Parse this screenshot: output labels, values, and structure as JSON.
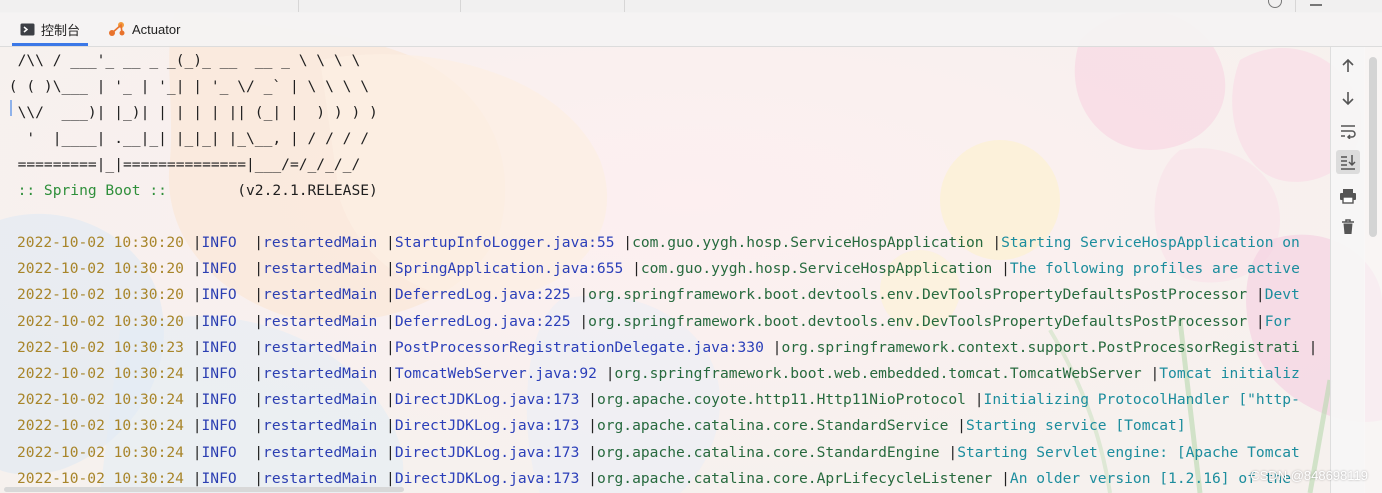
{
  "tabs": [
    {
      "label": "控制台",
      "icon": "console-icon",
      "active": true
    },
    {
      "label": "Actuator",
      "icon": "actuator-icon",
      "active": false
    }
  ],
  "banner": [
    "  /\\\\ / ___'_ __ _ _(_)_ __  __ _ \\ \\ \\ \\",
    " ( ( )\\___ | '_ | '_| | '_ \\/ _` | \\ \\ \\ \\",
    "  \\\\/  ___)| |_)| | | | | || (_| |  ) ) ) )",
    "   '  |____| .__|_| |_|_| |_\\__, | / / / /",
    "  =========|_|==============|___/=/_/_/_/"
  ],
  "spring_label": "  :: Spring Boot ::",
  "spring_version": "        (v2.2.1.RELEASE)",
  "log_lines": [
    {
      "ts": "2022-10-02 10:30:20",
      "level": "INFO ",
      "thread": "restartedMain",
      "source": "StartupInfoLogger.java:55",
      "logger": "com.guo.yygh.hosp.ServiceHospApplication",
      "message": "Starting ServiceHospApplication on"
    },
    {
      "ts": "2022-10-02 10:30:20",
      "level": "INFO ",
      "thread": "restartedMain",
      "source": "SpringApplication.java:655",
      "logger": "com.guo.yygh.hosp.ServiceHospApplication",
      "message": "The following profiles are active"
    },
    {
      "ts": "2022-10-02 10:30:20",
      "level": "INFO ",
      "thread": "restartedMain",
      "source": "DeferredLog.java:225",
      "logger": "org.springframework.boot.devtools.env.DevToolsPropertyDefaultsPostProcessor",
      "message": "Devt"
    },
    {
      "ts": "2022-10-02 10:30:20",
      "level": "INFO ",
      "thread": "restartedMain",
      "source": "DeferredLog.java:225",
      "logger": "org.springframework.boot.devtools.env.DevToolsPropertyDefaultsPostProcessor",
      "message": "For"
    },
    {
      "ts": "2022-10-02 10:30:23",
      "level": "INFO ",
      "thread": "restartedMain",
      "source": "PostProcessorRegistrationDelegate.java:330",
      "logger": "org.springframework.context.support.PostProcessorRegistrati",
      "message": ""
    },
    {
      "ts": "2022-10-02 10:30:24",
      "level": "INFO ",
      "thread": "restartedMain",
      "source": "TomcatWebServer.java:92",
      "logger": "org.springframework.boot.web.embedded.tomcat.TomcatWebServer",
      "message": "Tomcat initializ"
    },
    {
      "ts": "2022-10-02 10:30:24",
      "level": "INFO ",
      "thread": "restartedMain",
      "source": "DirectJDKLog.java:173",
      "logger": "org.apache.coyote.http11.Http11NioProtocol",
      "message": "Initializing ProtocolHandler [\"http-"
    },
    {
      "ts": "2022-10-02 10:30:24",
      "level": "INFO ",
      "thread": "restartedMain",
      "source": "DirectJDKLog.java:173",
      "logger": "org.apache.catalina.core.StandardService",
      "message": "Starting service [Tomcat]"
    },
    {
      "ts": "2022-10-02 10:30:24",
      "level": "INFO ",
      "thread": "restartedMain",
      "source": "DirectJDKLog.java:173",
      "logger": "org.apache.catalina.core.StandardEngine",
      "message": "Starting Servlet engine: [Apache Tomcat"
    },
    {
      "ts": "2022-10-02 10:30:24",
      "level": "INFO ",
      "thread": "restartedMain",
      "source": "DirectJDKLog.java:173",
      "logger": "org.apache.catalina.core.AprLifecycleListener",
      "message": "An older version [1.2.16] of the"
    }
  ],
  "toolbar": [
    {
      "icon": "scroll-up-icon"
    },
    {
      "icon": "scroll-down-icon"
    },
    {
      "icon": "soft-wrap-icon"
    },
    {
      "icon": "scroll-to-end-icon",
      "selected": true
    },
    {
      "icon": "print-icon"
    },
    {
      "icon": "clear-all-icon"
    }
  ],
  "watermark": "CSDN @848698119",
  "colors": {
    "timestamp": "#a8852a",
    "level": "#2c3fb2",
    "logger": "#276a3e",
    "message": "#1c8d9d",
    "accent": "#3b78e7"
  }
}
